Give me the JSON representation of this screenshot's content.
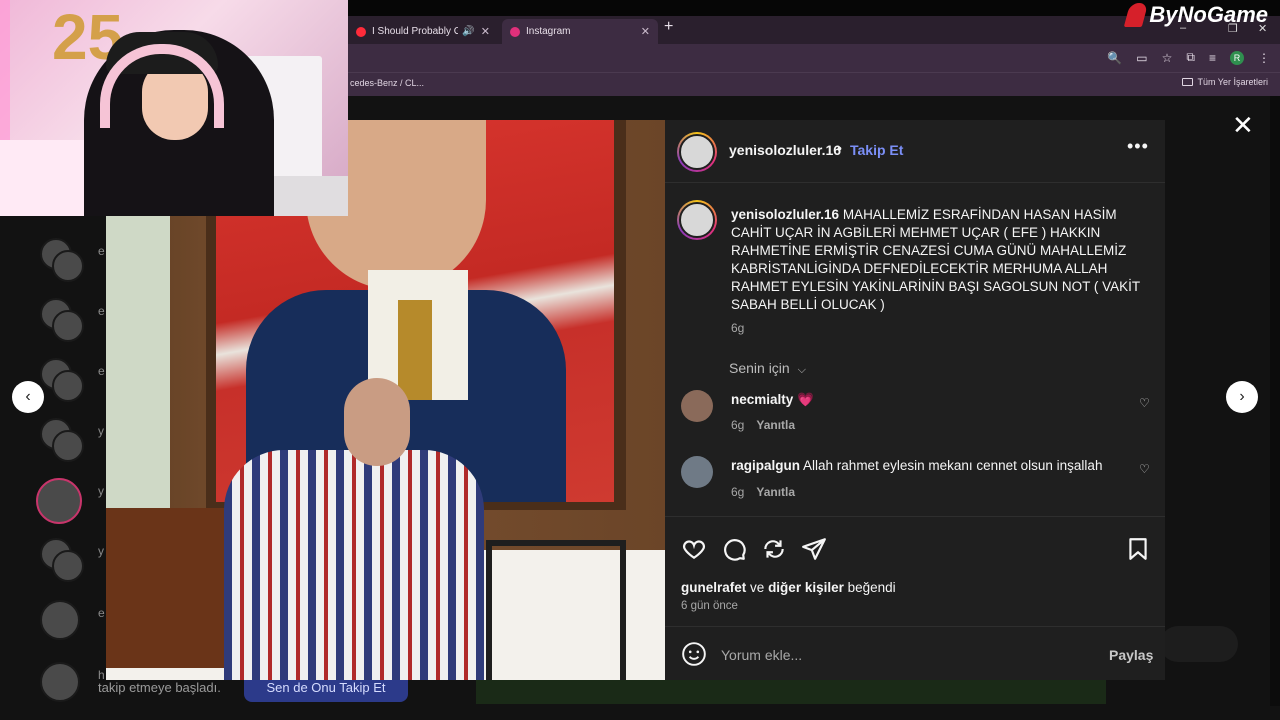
{
  "browser": {
    "tabs": [
      {
        "title": "I Should Probably Go to Be",
        "active": false,
        "favicon_color": "#ff2b3a"
      },
      {
        "title": "Instagram",
        "active": true,
        "favicon_color": "#e0307b"
      }
    ],
    "new_tab": "+",
    "window_controls": [
      "–",
      "❐",
      "✕"
    ],
    "bookmark_left": "cedes-Benz / CL...",
    "bookmark_folder": "Tüm Yer İşaretleri",
    "profile_initial": "R"
  },
  "watermark": "ByNoGame",
  "webcam": {
    "balloon_text": "25"
  },
  "background": {
    "follow_text": "takip etmeye başladı.",
    "follow_button": "Sen de Onu Takip Et",
    "list_letters": [
      "e",
      "e",
      "e",
      "y",
      "y",
      "y",
      "e",
      "h"
    ]
  },
  "modal": {
    "close": "✕",
    "prev": "‹",
    "next": "›",
    "post": {
      "username": "yenisolozluler.16",
      "dot": "•",
      "follow_label": "Takip Et",
      "more": "•••",
      "caption_user": "yenisolozluler.16",
      "caption_text": "MAHALLEMİZ ESRAFİNDAN HASAN HASİM CAHİT UÇAR İN AGBİLERİ MEHMET UÇAR ( EFE ) HAKKIN RAHMETİNE ERMİŞTİR CENAZESİ CUMA GÜNÜ MAHALLEMİZ KABRİSTANLİGİNDA DEFNEDİLECEKTİR MERHUMA ALLAH RAHMET EYLESİN YAKİNLARİNİN BAŞI SAGOLSUN NOT ( VAKİT SABAH BELLİ OLUCAK )",
      "caption_time": "6g",
      "for_you": "Senin için",
      "comments": [
        {
          "user": "necmialty",
          "text": "💗",
          "time": "6g",
          "reply": "Yanıtla",
          "avatar_color": "#8a6a5a"
        },
        {
          "user": "ragipalgun",
          "text": "Allah rahmet eylesin mekanı cennet olsun inşallah",
          "time": "6g",
          "reply": "Yanıtla",
          "avatar_color": "#6f7a86"
        }
      ],
      "likes_user": "gunelrafet",
      "likes_connector": "ve",
      "likes_others": "diğer kişiler",
      "likes_suffix": "beğendi",
      "posted_ago": "6 gün önce",
      "comment_placeholder": "Yorum ekle...",
      "share_label": "Paylaş"
    }
  }
}
